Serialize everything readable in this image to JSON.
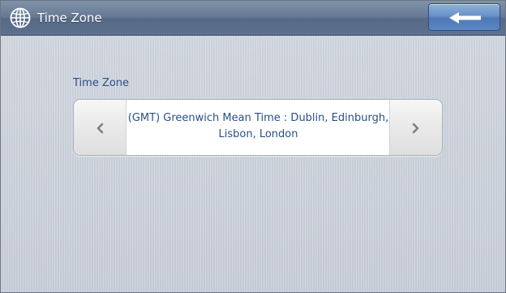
{
  "window": {
    "title": "Time Zone"
  },
  "icons": {
    "title_icon": "globe-icon",
    "back": "back-arrow-icon",
    "prev": "chevron-left-icon",
    "next": "chevron-right-icon"
  },
  "time_zone": {
    "label": "Time Zone",
    "selected_value": "(GMT) Greenwich Mean Time : Dublin, Edinburgh, Lisbon, London"
  },
  "colors": {
    "titlebar": "#657994",
    "back_button": "#5a86c3",
    "text_blue": "#2a4f86",
    "background": "#c7ced8"
  }
}
